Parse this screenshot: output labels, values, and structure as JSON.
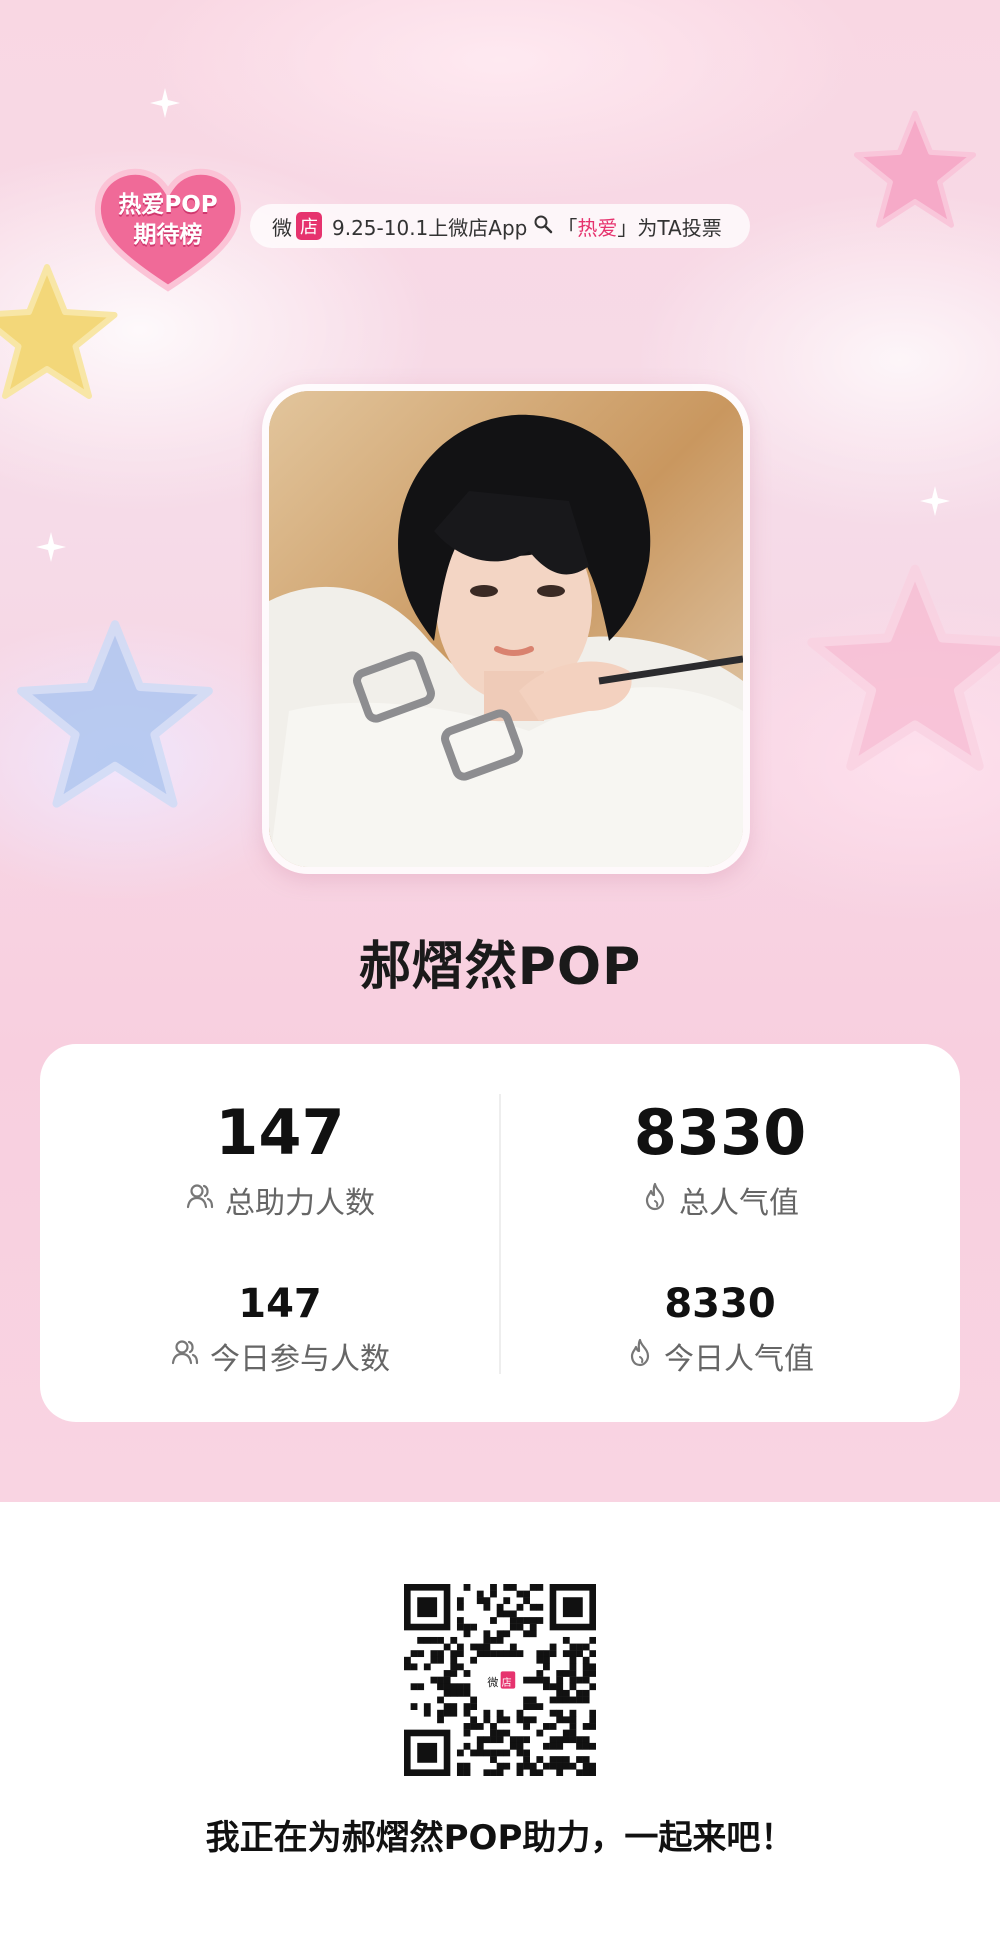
{
  "header": {
    "badge_line1": "热爱POP",
    "badge_line2": "期待榜",
    "notice": {
      "wei": "微",
      "dian": "店",
      "text_before": "9.25-10.1上微店App",
      "bracket_open": "「",
      "highlight": "热爱",
      "bracket_close": "」",
      "text_after": "为TA投票"
    }
  },
  "profile": {
    "name": "郝熠然POP"
  },
  "stats": {
    "total_helpers_value": "147",
    "total_helpers_label": "总助力人数",
    "total_popularity_value": "8330",
    "total_popularity_label": "总人气值",
    "today_participants_value": "147",
    "today_participants_label": "今日参与人数",
    "today_popularity_value": "8330",
    "today_popularity_label": "今日人气值"
  },
  "footer": {
    "qr_logo_wei": "微",
    "qr_logo_dian": "店",
    "share_text": "我正在为郝熠然POP助力，一起来吧！"
  },
  "colors": {
    "brand_pink": "#e6336e",
    "badge_pink": "#f06a98",
    "background_pink": "#f8d4e2"
  },
  "icons": [
    "heart-badge-icon",
    "search-icon",
    "people-icon",
    "flame-icon",
    "star-icon",
    "qr-code"
  ]
}
